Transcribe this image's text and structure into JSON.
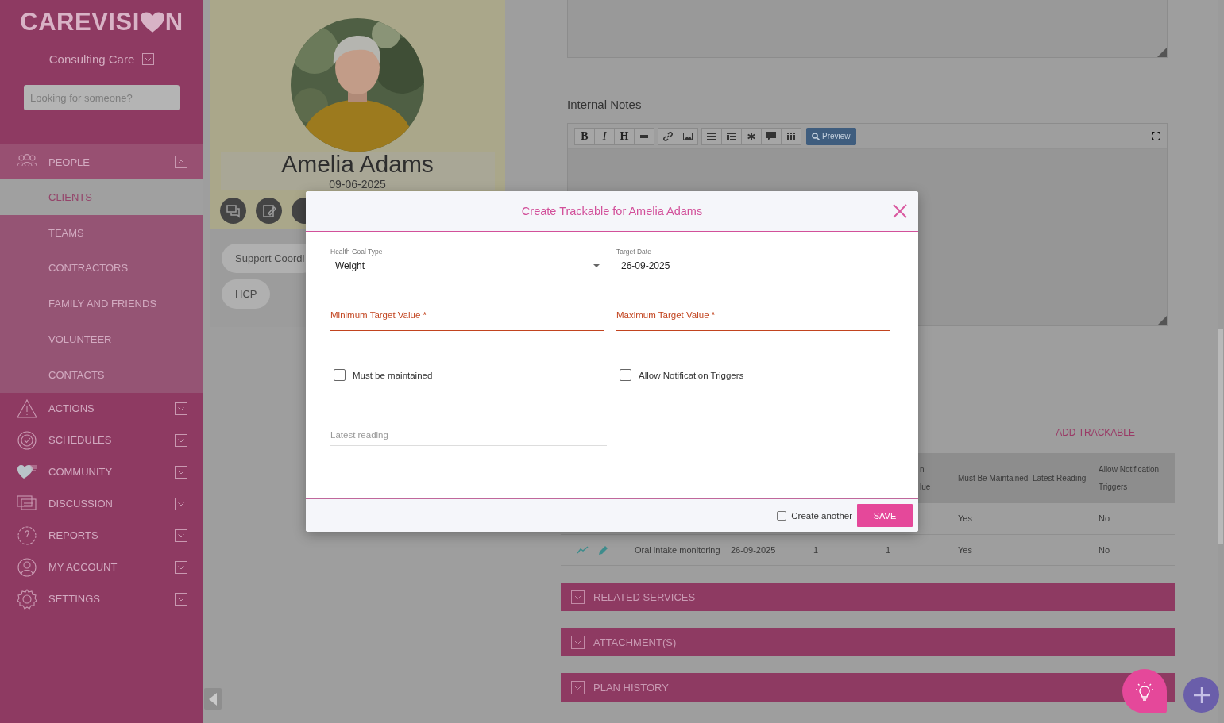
{
  "sidebar": {
    "logo": {
      "before": "CAREVISI",
      "after": "N"
    },
    "organization": "Consulting Care",
    "search": {
      "placeholder": "Looking for someone?"
    },
    "items": [
      {
        "label": "PEOPLE",
        "expanded": true,
        "children": [
          {
            "label": "CLIENTS",
            "selected": true
          },
          {
            "label": "TEAMS",
            "selected": false
          },
          {
            "label": "CONTRACTORS",
            "selected": false
          },
          {
            "label": "FAMILY AND FRIENDS",
            "selected": false
          },
          {
            "label": "VOLUNTEER",
            "selected": false
          },
          {
            "label": "CONTACTS",
            "selected": false
          }
        ]
      },
      {
        "label": "ACTIONS",
        "expanded": false
      },
      {
        "label": "SCHEDULES",
        "expanded": false
      },
      {
        "label": "COMMUNITY",
        "expanded": false
      },
      {
        "label": "DISCUSSION",
        "expanded": false
      },
      {
        "label": "REPORTS",
        "expanded": false
      },
      {
        "label": "MY ACCOUNT",
        "expanded": false
      },
      {
        "label": "SETTINGS",
        "expanded": false
      }
    ]
  },
  "profile": {
    "name": "Amelia Adams",
    "date": "09-06-2025",
    "tags": [
      "Support Coordi",
      "HCP"
    ]
  },
  "notes": {
    "label": "Internal Notes",
    "toolbar_letters": [
      "B",
      "I",
      "H"
    ],
    "preview": "Preview"
  },
  "trackables": {
    "add_link": "ADD TRACKABLE",
    "columns": [
      "",
      "",
      "",
      "",
      "n\nlue",
      "Must Be Maintained",
      "Latest Reading",
      "Allow Notification Triggers"
    ],
    "rows": [
      {
        "cells": [
          "",
          "",
          "",
          "",
          "",
          "Yes",
          "",
          "No"
        ]
      },
      {
        "icons": true,
        "cells": [
          "",
          "Oral intake monitoring",
          "26-09-2025",
          "1",
          "1",
          "Yes",
          "",
          "No"
        ]
      }
    ]
  },
  "sections": [
    {
      "label": "RELATED SERVICES",
      "expanded": false
    },
    {
      "label": "ATTACHMENT(S)",
      "expanded": false
    },
    {
      "label": "PLAN HISTORY",
      "expanded": false
    }
  ],
  "modal": {
    "title": "Create Trackable for Amelia Adams",
    "fields": [
      {
        "kind": "select",
        "label": "Health Goal Type",
        "value": "Weight",
        "error": false
      },
      {
        "kind": "date",
        "label": "Target Date",
        "value": "26-09-2025",
        "error": false
      },
      {
        "kind": "input",
        "label": "Minimum Target Value *",
        "error": true
      },
      {
        "kind": "input",
        "label": "Maximum Target Value *",
        "error": true
      },
      {
        "kind": "checkbox",
        "label": "Must be maintained",
        "checked": false
      },
      {
        "kind": "checkbox",
        "label": "Allow Notification Triggers",
        "checked": false
      },
      {
        "kind": "placeholder",
        "placeholder": "Latest reading",
        "error": false
      }
    ],
    "create_another": {
      "label": "Create another",
      "checked": false
    },
    "save": "SAVE"
  }
}
